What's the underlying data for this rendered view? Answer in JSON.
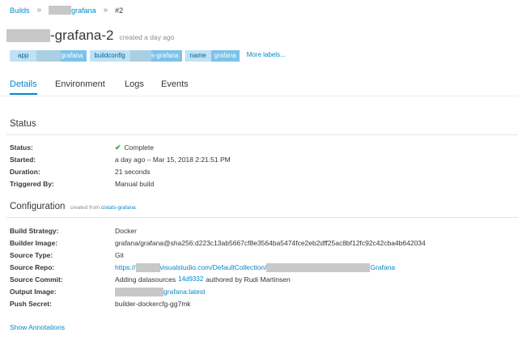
{
  "breadcrumb": {
    "builds_label": "Builds",
    "build_config_suffix": "grafana",
    "build_number": "#2",
    "separator": "»"
  },
  "header": {
    "title_suffix": "-grafana-2",
    "created": "created a day ago"
  },
  "labels": [
    {
      "key": "app",
      "value": "grafana"
    },
    {
      "key": "buildconfig",
      "value": "s-grafana"
    },
    {
      "key": "name",
      "value": "grafana"
    }
  ],
  "more_labels": "More labels...",
  "tabs": [
    "Details",
    "Environment",
    "Logs",
    "Events"
  ],
  "status": {
    "title": "Status",
    "rows": [
      {
        "label": "Status:",
        "value": "Complete"
      },
      {
        "label": "Started:",
        "value": "a day ago – Mar 15, 2018 2:21:51 PM"
      },
      {
        "label": "Duration:",
        "value": "21 seconds"
      },
      {
        "label": "Triggered By:",
        "value": "Manual build"
      }
    ]
  },
  "configuration": {
    "title": "Configuration",
    "created_from_prefix": "created from",
    "created_from_link": "cistats-grafana",
    "build_strategy": {
      "label": "Build Strategy:",
      "value": "Docker"
    },
    "builder_image": {
      "label": "Builder Image:",
      "value": "grafana/grafana@sha256:d223c13ab5667cf8e3564ba5474fce2eb2dff25ac8bf12fc92c42cba4b642034"
    },
    "source_type": {
      "label": "Source Type:",
      "value": "Git"
    },
    "source_repo": {
      "label": "Source Repo:",
      "prefix": "https://",
      "middle": "visualstudio.com/DefaultCollection/",
      "suffix": "Grafana"
    },
    "source_commit": {
      "label": "Source Commit:",
      "message": "Adding datasources",
      "hash": "14d9332",
      "author": "authored by Rudi Martinsen"
    },
    "output_image": {
      "label": "Output Image:",
      "suffix": "grafana:latest"
    },
    "push_secret": {
      "label": "Push Secret:",
      "value": "builder-dockercfg-gg7mk"
    }
  },
  "show_annotations": "Show Annotations",
  "colors": {
    "link": "#0088ce",
    "success": "#3f9c35",
    "label_key_bg": "#bee1f4",
    "label_value_bg": "#7dc3e8"
  }
}
